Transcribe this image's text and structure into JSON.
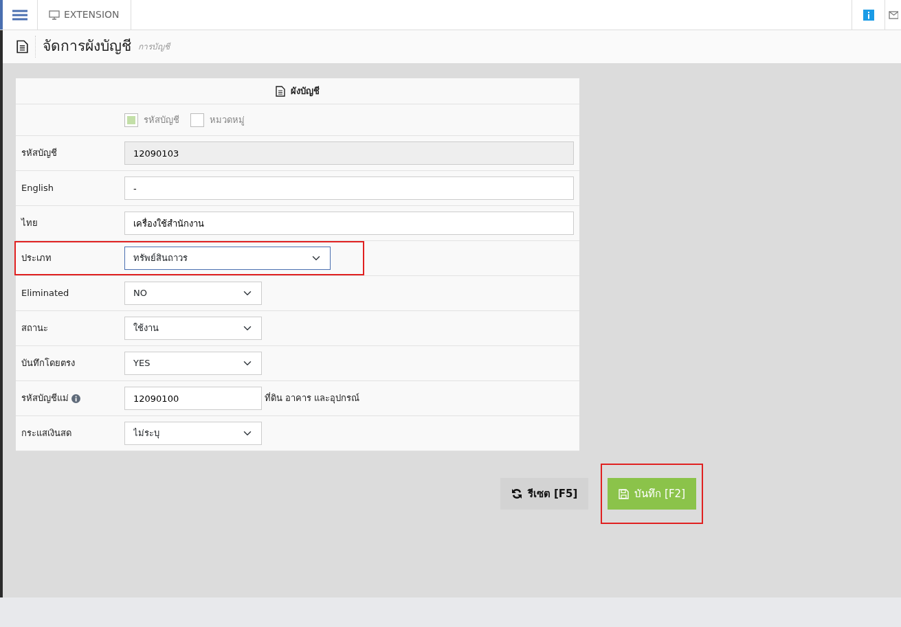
{
  "topbar": {
    "tab": "EXTENSION"
  },
  "page_header": {
    "title": "จัดการผังบัญชี",
    "subtitle": "การบัญชี"
  },
  "form": {
    "title": "ผังบัญชี",
    "options": [
      {
        "label": "รหัสบัญชี",
        "checked": true
      },
      {
        "label": "หมวดหมู่",
        "checked": false
      }
    ],
    "fields": [
      {
        "label": "รหัสบัญชี",
        "kind": "textwide",
        "value": "12090103",
        "readonly": true
      },
      {
        "label": "English",
        "kind": "textwide",
        "value": "-",
        "readonly": false
      },
      {
        "label": "ไทย",
        "kind": "textwide",
        "value": "เครื่องใช้สำนักงาน",
        "readonly": false
      },
      {
        "label": "ประเภท",
        "kind": "selectwide",
        "value": "ทรัพย์สินถาวร",
        "highlighted": true
      },
      {
        "label": "Eliminated",
        "kind": "select",
        "value": "NO"
      },
      {
        "label": "สถานะ",
        "kind": "select",
        "value": "ใช้งาน"
      },
      {
        "label": "บันทึกโดยตรง",
        "kind": "select",
        "value": "YES"
      },
      {
        "label": "รหัสบัญชีแม่",
        "kind": "lookup",
        "value": "12090100",
        "note": "ที่ดิน อาคาร และอุปกรณ์",
        "info": true
      },
      {
        "label": "กระแสเงินสด",
        "kind": "select",
        "value": "ไม่ระบุ"
      }
    ]
  },
  "buttons": [
    {
      "kind": "reset",
      "label": "รีเซต [F5]",
      "highlighted": false
    },
    {
      "kind": "save",
      "label": "บันทึก [F2]",
      "highlighted": true
    }
  ]
}
